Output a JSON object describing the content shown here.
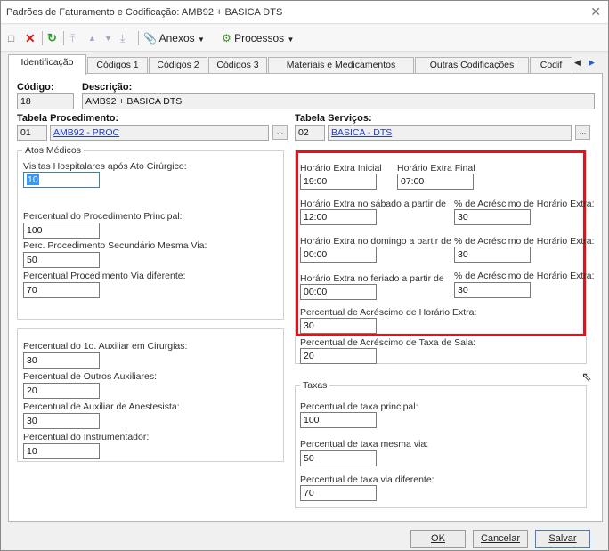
{
  "window": {
    "title": "Padrões de Faturamento e Codificação: AMB92 + BASICA DTS"
  },
  "toolbar": {
    "anexos": "Anexos",
    "processos": "Processos"
  },
  "tabs": [
    "Identificação",
    "Códigos 1",
    "Códigos 2",
    "Códigos 3",
    "Materiais e Medicamentos",
    "Outras Codificações",
    "Codif"
  ],
  "header": {
    "codigo_label": "Código:",
    "codigo_value": "18",
    "descricao_label": "Descrição:",
    "descricao_value": "AMB92 + BASICA DTS",
    "tab_proc_label": "Tabela Procedimento:",
    "tab_proc_code": "01",
    "tab_proc_name": "AMB92 - PROC",
    "tab_serv_label": "Tabela Serviços:",
    "tab_serv_code": "02",
    "tab_serv_name": "BASICA - DTS",
    "lookup_glyph": "..."
  },
  "atos": {
    "title": "Atos Médicos",
    "visitas_label": "Visitas Hospitalares após Ato Cirúrgico:",
    "visitas_value": "10",
    "perc_principal_label": "Percentual do Procedimento Principal:",
    "perc_principal_value": "100",
    "perc_secundario_label": "Perc. Procedimento Secundário Mesma Via:",
    "perc_secundario_value": "50",
    "perc_via_dif_label": "Percentual Procedimento Via diferente:",
    "perc_via_dif_value": "70"
  },
  "auxiliares": {
    "aux1_label": "Percentual do 1o. Auxiliar em Cirurgias:",
    "aux1_value": "30",
    "outros_label": "Percentual de Outros Auxiliares:",
    "outros_value": "20",
    "anest_label": "Percentual de Auxiliar de Anestesista:",
    "anest_value": "30",
    "instr_label": "Percentual do Instrumentador:",
    "instr_value": "10"
  },
  "horario": {
    "inicial_label": "Horário Extra Inicial",
    "inicial_value": "19:00",
    "final_label": "Horário Extra Final",
    "final_value": "07:00",
    "sabado_label": "Horário Extra no sábado a partir de",
    "sabado_value": "12:00",
    "acresc_label": "% de Acréscimo de Horário Extra:",
    "sabado_acresc_value": "30",
    "domingo_label": "Horário Extra no domingo a partir de",
    "domingo_value": "00:00",
    "domingo_acresc_value": "30",
    "feriado_label": "Horário Extra no feriado a partir de",
    "feriado_value": "00:00",
    "feriado_acresc_value": "30",
    "perc_acresc_label": "Percentual de Acréscimo de Horário Extra:",
    "perc_acresc_value": "30",
    "taxa_sala_label": "Percentual de Acréscimo de Taxa de Sala:",
    "taxa_sala_value": "20"
  },
  "taxas": {
    "title": "Taxas",
    "principal_label": "Percentual de taxa principal:",
    "principal_value": "100",
    "mesma_via_label": "Percentual de taxa mesma via:",
    "mesma_via_value": "50",
    "via_dif_label": "Percentual de taxa via diferente:",
    "via_dif_value": "70"
  },
  "buttons": {
    "ok": "OK",
    "cancelar": "Cancelar",
    "salvar": "Salvar"
  },
  "colors": {
    "highlight": "#d8161b",
    "link": "#1d3bd8",
    "selection": "#3399ff"
  }
}
